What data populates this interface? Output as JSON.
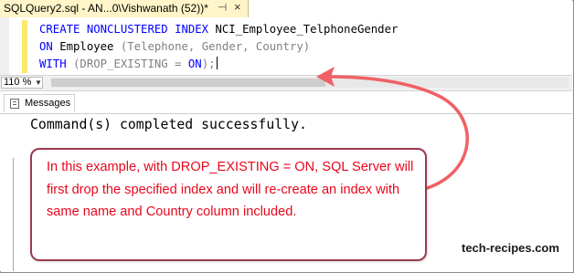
{
  "tab": {
    "title": "SQLQuery2.sql - AN...0\\Vishwanath (52))*",
    "pin_glyph": "⊣",
    "close_glyph": "×"
  },
  "editor": {
    "line1_kw": "CREATE NONCLUSTERED INDEX",
    "line1_rest": " NCI_Employee_TelphoneGender",
    "line2_kw": "ON",
    "line2_rest": " Employee ",
    "line2_paren": "(Telephone, Gender, Country)",
    "line3_kw": "WITH",
    "line3_paren": " (DROP_EXISTING = ",
    "line3_on": "ON",
    "line3_end": ");"
  },
  "zoom": {
    "value": "110 %"
  },
  "results": {
    "tab_label": "Messages",
    "message": "Command(s) completed successfully."
  },
  "callout": {
    "text": "In this example, with DROP_EXISTING = ON, SQL Server will first drop the specified index and will re-create an index with same name and Country column included.",
    "color": "#e8071c",
    "border_color": "#9b3b4f"
  },
  "arrow": {
    "color": "#f06065"
  },
  "watermark": "tech-recipes.com"
}
